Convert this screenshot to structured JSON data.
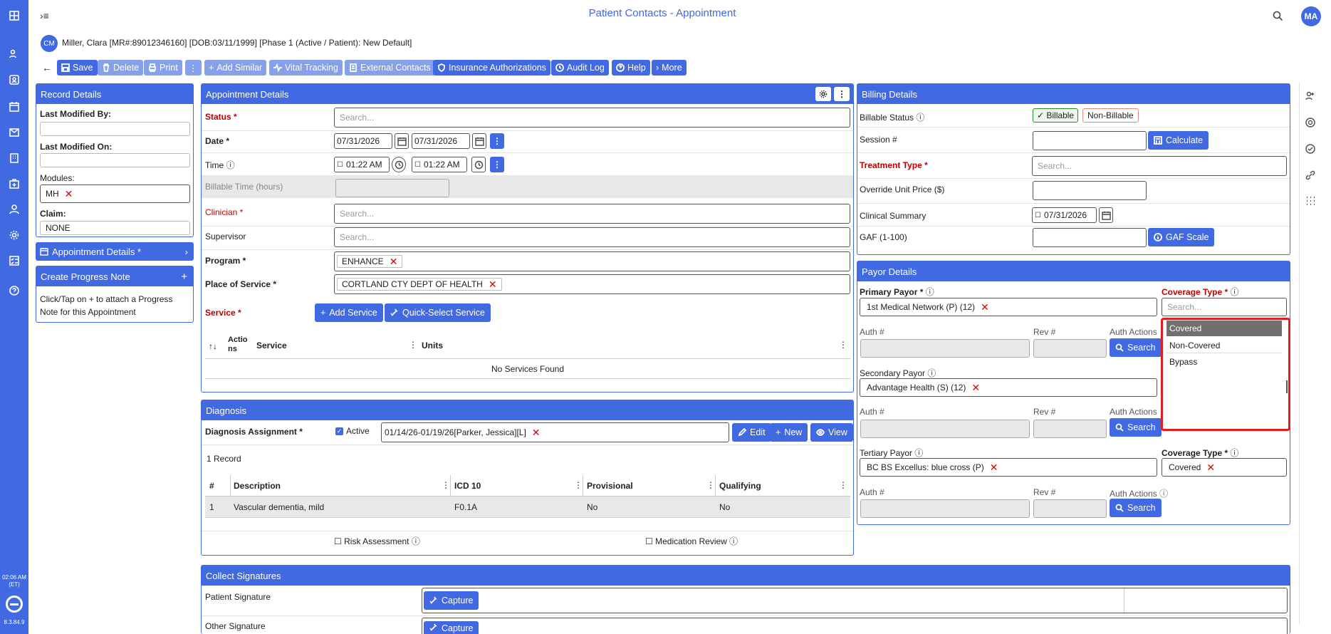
{
  "app": {
    "title": "Patient Contacts - Appointment",
    "user_initials": "MA",
    "clock": "02:06 AM",
    "clock_tz": "(ET)",
    "version": "8.3.84.9"
  },
  "patient": {
    "initials": "CM",
    "info": "Miller, Clara [MR#:89012346160] [DOB:03/11/1999] [Phase 1 (Active / Patient): New Default]"
  },
  "toolbar": {
    "save": "Save",
    "delete": "Delete",
    "print": "Print",
    "add_similar": "Add Similar",
    "vital_tracking": "Vital Tracking",
    "external_contacts": "External Contacts",
    "insurance_auth": "Insurance Authorizations",
    "audit_log": "Audit Log",
    "help": "Help",
    "more": "More"
  },
  "record": {
    "header": "Record Details",
    "last_modified_by": "Last Modified By:",
    "last_modified_on": "Last Modified On:",
    "modules_label": "Modules:",
    "module_chip": "MH",
    "claim_label": "Claim:",
    "claim_value": "NONE",
    "appt_details_link": "Appointment Details *",
    "create_progress": "Create Progress Note",
    "progress_help": "Click/Tap on + to attach a Progress Note for this Appointment"
  },
  "appt": {
    "header": "Appointment Details",
    "status": "Status *",
    "status_ph": "Search...",
    "date": "Date *",
    "date1": "07/31/2026",
    "date2": "07/31/2026",
    "time": "Time",
    "time1": "01:22 AM",
    "time2": "01:22 AM",
    "billable_time": "Billable Time (hours)",
    "clinician": "Clinician *",
    "clinician_ph": "Search...",
    "supervisor": "Supervisor",
    "supervisor_ph": "Search...",
    "program": "Program *",
    "program_chip": "ENHANCE",
    "pos": "Place of Service *",
    "pos_chip": "CORTLAND CTY DEPT OF HEALTH",
    "service": "Service *",
    "add_service": "Add Service",
    "quick_select": "Quick-Select Service",
    "col_sort": "↑↓",
    "col_actions": "Actions",
    "col_service": "Service",
    "col_units": "Units",
    "no_services": "No Services Found"
  },
  "diag": {
    "header": "Diagnosis",
    "assignment": "Diagnosis Assignment *",
    "active": "Active",
    "chip": "01/14/26-01/19/26[Parker, Jessica][L]",
    "edit": "Edit",
    "new": "New",
    "view": "View",
    "count": "1 Record",
    "cols": [
      "#",
      "Description",
      "ICD 10",
      "Provisional",
      "Qualifying"
    ],
    "row": [
      "1",
      "Vascular dementia, mild",
      "F0.1A",
      "No",
      "No"
    ],
    "risk": "Risk Assessment",
    "med_review": "Medication Review"
  },
  "billing": {
    "header": "Billing Details",
    "billable_status": "Billable Status",
    "billable": "✓ Billable",
    "non_billable": "Non-Billable",
    "session": "Session #",
    "calculate": "Calculate",
    "treatment": "Treatment Type *",
    "treatment_ph": "Search...",
    "override": "Override Unit Price ($)",
    "clinical_summary": "Clinical Summary",
    "cs_date": "07/31/2026",
    "gaf": "GAF (1-100)",
    "gaf_scale": "GAF Scale"
  },
  "payor": {
    "header": "Payor Details",
    "primary": "Primary Payor *",
    "primary_chip": "1st Medical Network (P) (12)",
    "coverage": "Coverage Type *",
    "coverage_ph": "Search...",
    "auth": "Auth #",
    "rev": "Rev #",
    "auth_actions": "Auth Actions",
    "search": "Search",
    "secondary": "Secondary Payor",
    "secondary_chip": "Advantage Health (S) (12)",
    "tertiary": "Tertiary Payor",
    "tertiary_chip": "BC BS Excellus: blue cross (P)",
    "tert_coverage": "Coverage Type *",
    "tert_coverage_chip": "Covered",
    "dropdown": [
      "Covered",
      "Non-Covered",
      "Bypass"
    ]
  },
  "signatures": {
    "header": "Collect Signatures",
    "patient": "Patient Signature",
    "other": "Other Signature",
    "capture": "Capture"
  },
  "colors": {
    "brand": "#4169e1",
    "required": "#c00000",
    "highlight": "#e02020"
  }
}
